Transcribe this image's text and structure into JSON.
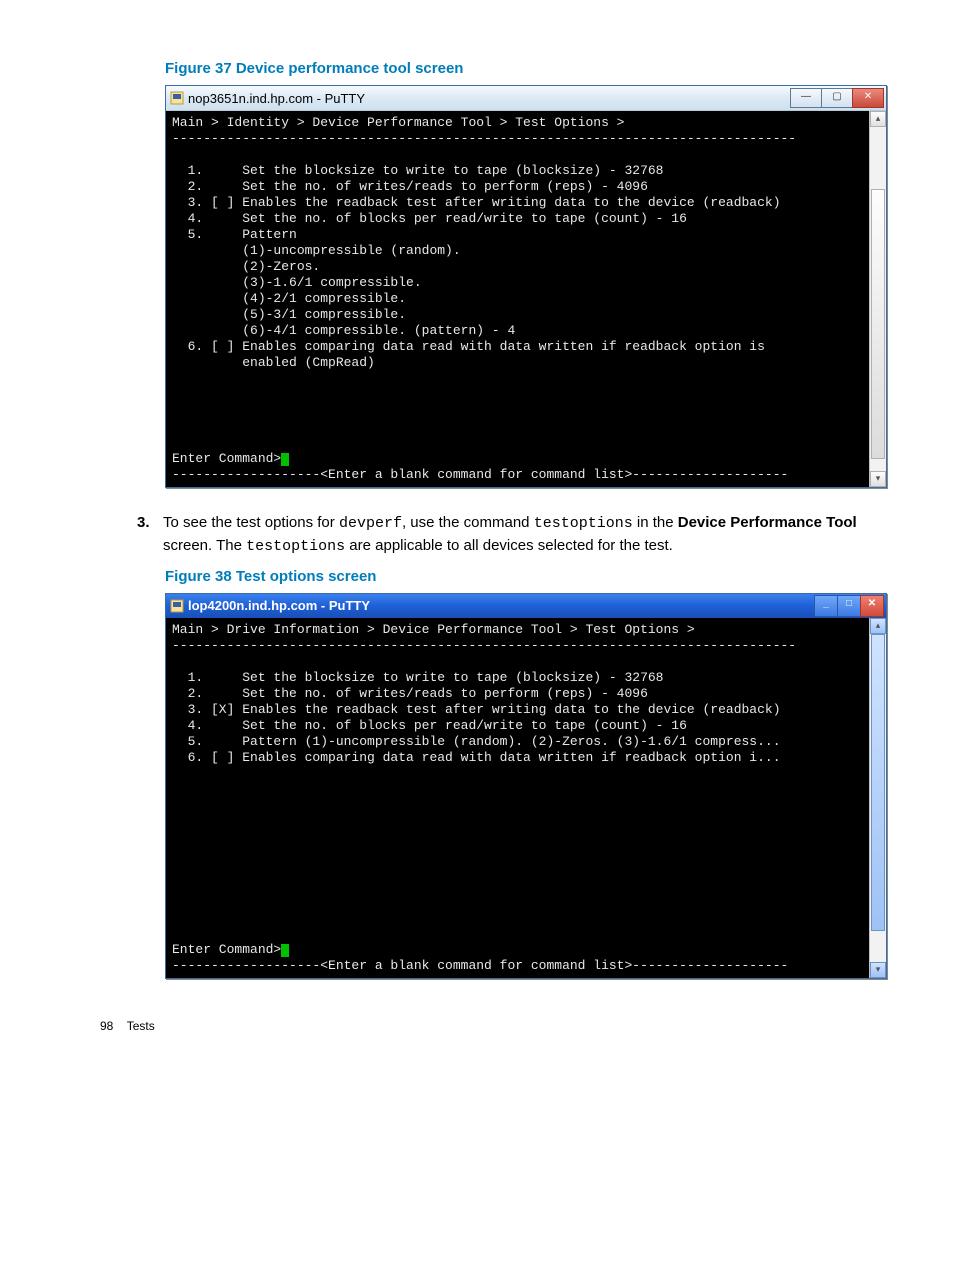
{
  "figure37": {
    "caption": "Figure 37 Device performance tool screen",
    "window_title": "nop3651n.ind.hp.com - PuTTY",
    "lines": [
      "Main > Identity > Device Performance Tool > Test Options >",
      "--------------------------------------------------------------------------------",
      "",
      "  1.     Set the blocksize to write to tape (blocksize) - 32768",
      "  2.     Set the no. of writes/reads to perform (reps) - 4096",
      "  3. [ ] Enables the readback test after writing data to the device (readback)",
      "  4.     Set the no. of blocks per read/write to tape (count) - 16",
      "  5.     Pattern",
      "         (1)-uncompressible (random).",
      "         (2)-Zeros.",
      "         (3)-1.6/1 compressible.",
      "         (4)-2/1 compressible.",
      "         (5)-3/1 compressible.",
      "         (6)-4/1 compressible. (pattern) - 4",
      "  6. [ ] Enables comparing data read with data written if readback option is",
      "         enabled (CmpRead)",
      "",
      "",
      "",
      "",
      ""
    ],
    "prompt": "Enter Command>",
    "hint": "-------------------<Enter a blank command for command list>--------------------"
  },
  "step3": {
    "num": "3.",
    "t1": "To see the test options for ",
    "code1": "devperf",
    "t2": ", use the command ",
    "code2": "testoptions",
    "t3": " in the ",
    "bold": "Device Performance Tool",
    "t4": " screen. The ",
    "code3": "testoptions",
    "t5": " are applicable to all devices selected for the test."
  },
  "figure38": {
    "caption": "Figure 38 Test options screen",
    "window_title": "lop4200n.ind.hp.com - PuTTY",
    "lines": [
      "Main > Drive Information > Device Performance Tool > Test Options >",
      "--------------------------------------------------------------------------------",
      "",
      "  1.     Set the blocksize to write to tape (blocksize) - 32768",
      "  2.     Set the no. of writes/reads to perform (reps) - 4096",
      "  3. [X] Enables the readback test after writing data to the device (readback)",
      "  4.     Set the no. of blocks per read/write to tape (count) - 16",
      "  5.     Pattern (1)-uncompressible (random). (2)-Zeros. (3)-1.6/1 compress...",
      "  6. [ ] Enables comparing data read with data written if readback option i...",
      "",
      "",
      "",
      "",
      "",
      "",
      "",
      "",
      "",
      "",
      ""
    ],
    "prompt": "Enter Command>",
    "hint": "-------------------<Enter a blank command for command list>--------------------"
  },
  "footer": {
    "page": "98",
    "section": "Tests"
  }
}
